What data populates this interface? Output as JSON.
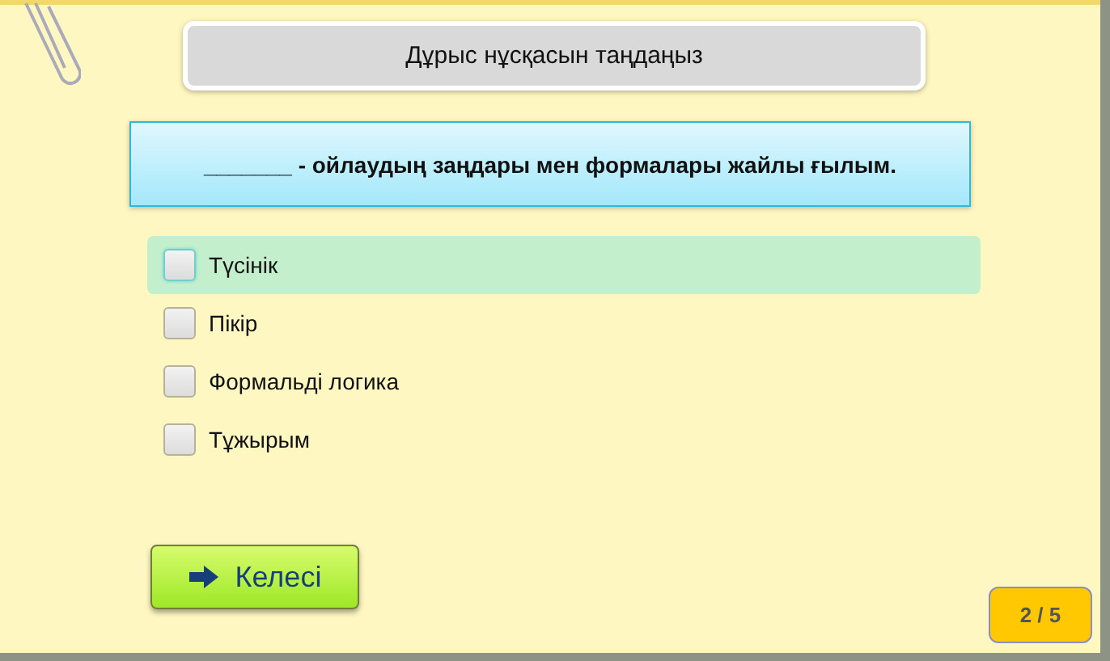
{
  "header": {
    "title": "Дұрыс нұсқасын таңдаңыз"
  },
  "question": {
    "text": "_______ - ойлаудың заңдары мен формалары жайлы ғылым."
  },
  "options": [
    {
      "label": "Түсінік",
      "checked": false,
      "highlighted": true
    },
    {
      "label": "Пікір",
      "checked": false,
      "highlighted": false
    },
    {
      "label": "Формальді логика",
      "checked": false,
      "highlighted": false
    },
    {
      "label": "Тұжырым",
      "checked": false,
      "highlighted": false
    }
  ],
  "next_button": {
    "label": "Келесі"
  },
  "progress": {
    "text": "2 / 5"
  }
}
